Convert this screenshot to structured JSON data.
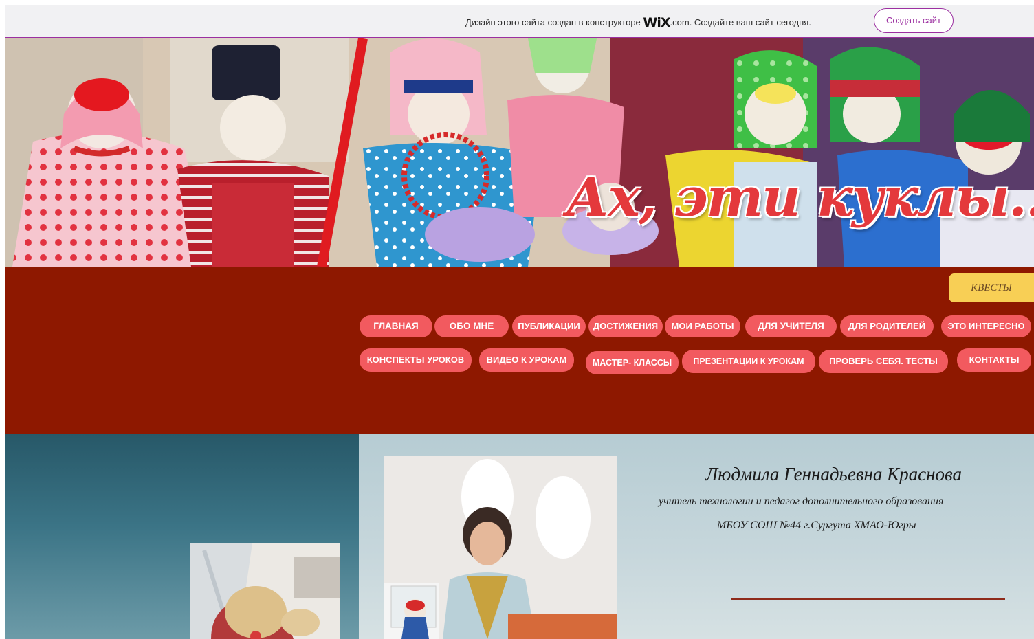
{
  "wix_banner": {
    "text_before_logo": "Дизайн этого сайта создан в конструкторе",
    "logo_mark": "WiX",
    "text_after_logo": ".com. Создайте ваш сайт сегодня.",
    "cta_label": "Создать сайт",
    "accent_color": "#9b2fa0"
  },
  "header": {
    "title": "Ах, эти куклы..."
  },
  "menu": {
    "quest_label": "КВЕСТЫ",
    "row1": [
      "ГЛАВНАЯ",
      "ОБО МНЕ",
      "ПУБЛИКАЦИИ",
      "ДОСТИЖЕНИЯ",
      "МОИ РАБОТЫ",
      "ДЛЯ УЧИТЕЛЯ",
      "ДЛЯ РОДИТЕЛЕЙ",
      "ЭТО ИНТЕРЕСНО"
    ],
    "row2": [
      "КОНСПЕКТЫ УРОКОВ",
      "ВИДЕО К УРОКАМ",
      "МАСТЕР- КЛАССЫ",
      "ПРЕЗЕНТАЦИИ К УРОКАМ",
      "ПРОВЕРЬ СЕБЯ. ТЕСТЫ",
      "КОНТАКТЫ"
    ],
    "background_color": "#8e1800",
    "pill_color": "#f25a5f",
    "quest_color": "#f8cf55"
  },
  "profile": {
    "name": "Людмила Геннадьевна Краснова",
    "role": "учитель технологии и педагог дополнительного образования",
    "school": "МБОУ СОШ №44 г.Сургута ХМАО-Югры"
  }
}
